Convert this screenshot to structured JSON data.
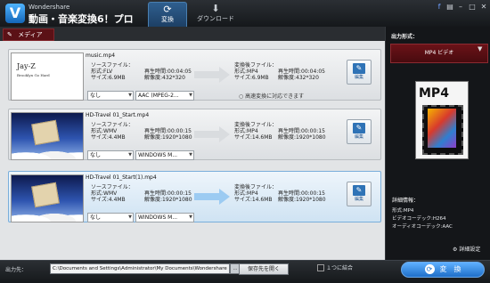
{
  "app": {
    "brand": "Wondershare",
    "title": "動画・音楽変換6！プロ"
  },
  "tabs": {
    "convert": "変換",
    "download": "ダウンロード"
  },
  "toolbar": {
    "media_label": "メディア"
  },
  "rows": [
    {
      "filename": "music.mp4",
      "thumb_line1": "Jay-Z",
      "thumb_line2": "Brooklyn Go Hard",
      "src_label": "ソースファイル：",
      "src_format": "形式:FLV",
      "src_size": "サイズ:6.9MB",
      "src_duration": "再生時間:00:04:05",
      "src_resolution": "解像度:432*320",
      "dst_label": "変換後ファイル：",
      "dst_format": "形式:MP4",
      "dst_size": "サイズ:6.9MB",
      "dst_duration": "再生時間:00:04:05",
      "dst_resolution": "解像度:432*320",
      "edit_label": "編集",
      "subtitle_value": "なし",
      "audio_value": "AAC (MPEG-2...",
      "radio_label": "高速変換に対応できます"
    },
    {
      "filename": "HD-Travel 01_Start.mp4",
      "src_label": "ソースファイル：",
      "src_format": "形式:WMV",
      "src_size": "サイズ:4.4MB",
      "src_duration": "再生時間:00:00:15",
      "src_resolution": "解像度:1920*1080",
      "dst_label": "変換後ファイル：",
      "dst_format": "形式:MP4",
      "dst_size": "サイズ:14.6MB",
      "dst_duration": "再生時間:00:00:15",
      "dst_resolution": "解像度:1920*1080",
      "edit_label": "編集",
      "subtitle_value": "なし",
      "audio_value": "WINDOWS M..."
    },
    {
      "filename": "HD-Travel 01_Start(1).mp4",
      "src_label": "ソースファイル：",
      "src_format": "形式:WMV",
      "src_size": "サイズ:4.4MB",
      "src_duration": "再生時間:00:00:15",
      "src_resolution": "解像度:1920*1080",
      "dst_label": "変換後ファイル：",
      "dst_format": "形式:MP4",
      "dst_size": "サイズ:14.6MB",
      "dst_duration": "再生時間:00:00:15",
      "dst_resolution": "解像度:1920*1080",
      "edit_label": "編集",
      "subtitle_value": "なし",
      "audio_value": "WINDOWS M..."
    }
  ],
  "output": {
    "label": "出力形式：",
    "format": "MP4 ビデオ",
    "tile_text": "MP4",
    "detail_heading": "詳細情報：",
    "detail_format": "形式:MP4",
    "detail_video_codec": "ビデオコーデック:H264",
    "detail_audio_codec": "オーディオコーデック:AAC",
    "settings_label": "詳細設定"
  },
  "bottom": {
    "dest_label": "出力先：",
    "path": "C:\\Documents and Settings\\Administrator\\My Documents\\Wondershare",
    "browse_label": "…",
    "open_label": "保存先を開く",
    "merge_label": "１つに結合",
    "convert_label": "変　換"
  },
  "icons": {
    "logo": "wondershare-logo",
    "convert_tab": "convert-icon",
    "download_tab": "download-icon",
    "media": "media-icon",
    "edit": "edit-icon",
    "settings": "settings-icon",
    "convert": "convert-icon"
  },
  "colors": {
    "accent_blue": "#1f6fc9",
    "media_red": "#5b1116",
    "format_red": "#6b1218"
  }
}
